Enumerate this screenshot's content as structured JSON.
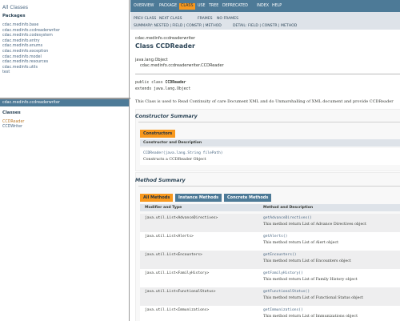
{
  "left_top": {
    "all_classes": "All Classes",
    "packages_heading": "Packages",
    "packages": [
      "cdac.medinfo.base",
      "cdac.medinfo.ccdreaderwriter",
      "cdac.medinfo.codesystem",
      "cdac.medinfo.entry",
      "cdac.medinfo.enums",
      "cdac.medinfo.exception",
      "cdac.medinfo.model",
      "cdac.medinfo.resources",
      "cdac.medinfo.utils",
      "test"
    ]
  },
  "left_bottom": {
    "package_bar": "cdac.medinfo.ccdreaderwriter",
    "classes_heading": "Classes",
    "classes": [
      "CCDReader",
      "CCDWriter"
    ]
  },
  "topnav": {
    "overview": "OVERVIEW",
    "package": "PACKAGE",
    "class": "CLASS",
    "use": "USE",
    "tree": "TREE",
    "deprecated": "DEPRECATED",
    "index": "INDEX",
    "help": "HELP"
  },
  "subnav": {
    "prev_class": "PREV CLASS",
    "next_class": "NEXT CLASS",
    "frames": "FRAMES",
    "no_frames": "NO FRAMES",
    "summary": "SUMMARY: NESTED | FIELD | CONSTR | METHOD",
    "detail": "DETAIL: FIELD | CONSTR | METHOD"
  },
  "header": {
    "package_name": "cdac.medinfo.ccdreaderwriter",
    "class_title": "Class CCDReader",
    "inheritance_1": "java.lang.Object",
    "inheritance_2": "cdac.medinfo.ccdreaderwriter.CCDReader"
  },
  "signature": {
    "prefix": "public class ",
    "name": "CCDReader",
    "extends": "extends java.lang.Object"
  },
  "description": "This Class is used to Read Continuity of care Document XML and do Unmarshalling of XML document and provide CCDReader",
  "constructor_summary": {
    "title": "Constructor Summary",
    "tab": "Constructors",
    "header": "Constructor and Description",
    "signature": "CCDReader(java.lang.String filePath)",
    "description": "Constructs a CCDReader Object"
  },
  "method_summary": {
    "title": "Method Summary",
    "tabs": {
      "all": "All Methods",
      "instance": "Instance Methods",
      "concrete": "Concrete Methods"
    },
    "header_type": "Modifier and Type",
    "header_method": "Method and Description",
    "rows": [
      {
        "type": "java.util.List<AdvanceDirectives>",
        "name": "getAdvanceDirectives()",
        "desc": "This method return List of Advance Directives object"
      },
      {
        "type": "java.util.List<Alerts>",
        "name": "getAlerts()",
        "desc": "This method return List of Alert object"
      },
      {
        "type": "java.util.List<Encounters>",
        "name": "getEncounters()",
        "desc": "This method return List of Encounters object"
      },
      {
        "type": "java.util.List<FamilyHistory>",
        "name": "getFamilyHistory()",
        "desc": "This method return List of Family History object"
      },
      {
        "type": "java.util.List<FunctionalStatus>",
        "name": "getFunctionalStatus()",
        "desc": "This method return List of Functional Status object"
      },
      {
        "type": "java.util.List<Immunizations>",
        "name": "getImmunizations()",
        "desc": "This method return List of Immunizations object"
      }
    ]
  },
  "colors": {
    "nav_blue": "#4d7a97",
    "active_orange": "#f8981d",
    "subnav_gray": "#dee3e9",
    "link_blue": "#4a6782"
  }
}
